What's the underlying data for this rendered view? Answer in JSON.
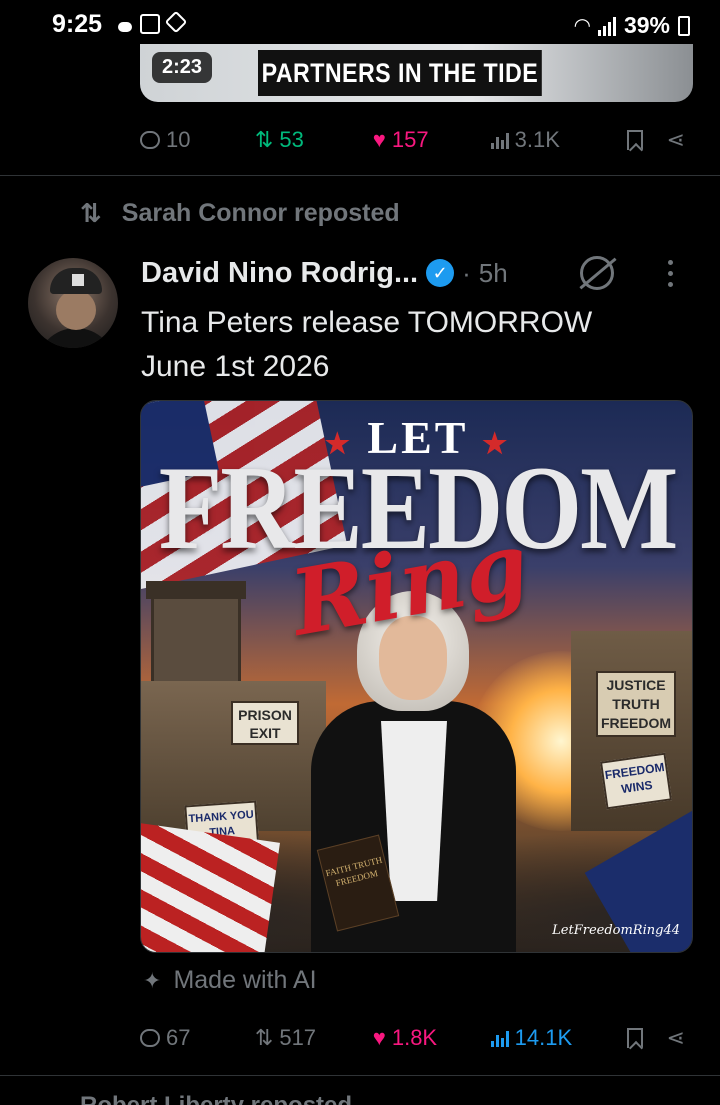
{
  "status_bar": {
    "time": "9:25",
    "battery": "39%"
  },
  "video": {
    "duration": "2:23",
    "title": "PARTNERS IN THE TIDE"
  },
  "prev_post_actions": {
    "replies": "10",
    "reposts": "53",
    "likes": "157",
    "views": "3.1K"
  },
  "repost_line": {
    "text": "Sarah Connor reposted"
  },
  "post": {
    "author_name": "David Nino Rodrig...",
    "separator": "·",
    "age": "5h",
    "text_line1": "Tina Peters release TOMORROW",
    "text_line2": "June 1st 2026",
    "ai_label": "Made with AI",
    "actions": {
      "replies": "67",
      "reposts": "517",
      "likes": "1.8K",
      "views": "14.1K"
    }
  },
  "image": {
    "let": "LET",
    "freedom": "FREEDOM",
    "ring": "Ring",
    "sign_prison": "PRISON EXIT",
    "sign_justice": "JUSTICE TRUTH FREEDOM",
    "sign_thank": "THANK YOU TINA PETERS!",
    "sign_wins": "FREEDOM WINS",
    "bible": "FAITH TRUTH FREEDOM",
    "watermark": "LetFreedomRing44"
  },
  "next_post_peek": "Robert Liberty reposted",
  "colors": {
    "background": "#000000",
    "text": "#e7e9ea",
    "muted": "#71767b",
    "repost_green": "#00ba7c",
    "like_pink": "#f91880",
    "verified_blue": "#1d9bf0"
  }
}
